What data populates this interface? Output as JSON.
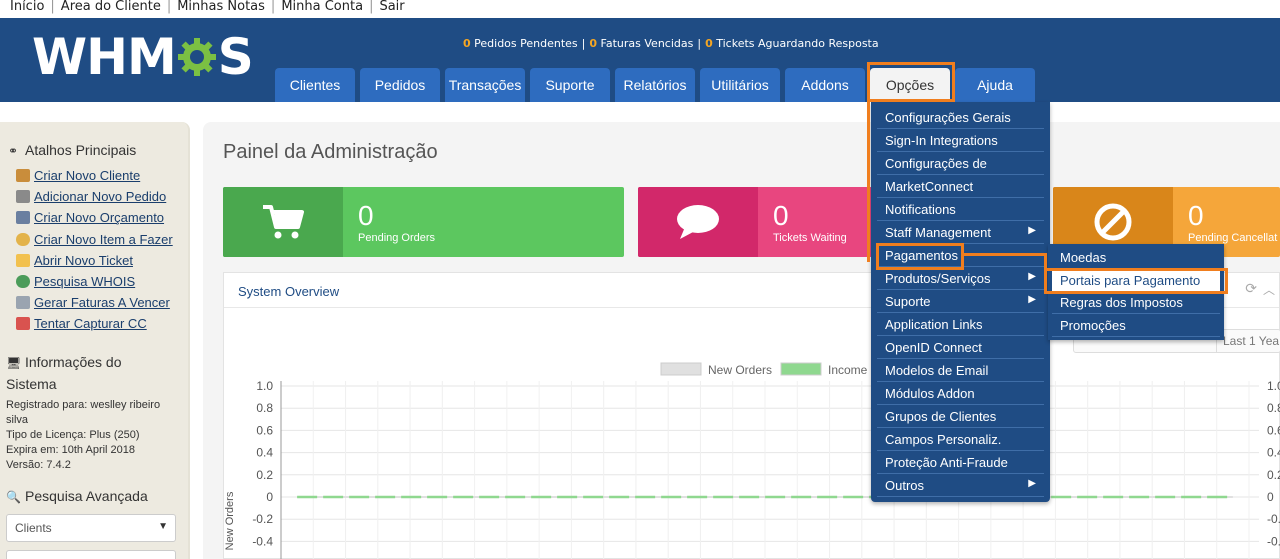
{
  "toplinks": [
    "Início",
    "Área do Cliente",
    "Minhas Notas",
    "Minha Conta",
    "Sair"
  ],
  "header": {
    "logo_left": "WHM",
    "logo_right": "S",
    "stats": {
      "pending_orders_num": "0",
      "pending_orders": "Pedidos Pendentes",
      "overdue_num": "0",
      "overdue": "Faturas Vencidas",
      "tickets_num": "0",
      "tickets": "Tickets Aguardando Resposta"
    },
    "tabs": [
      "Clientes",
      "Pedidos",
      "Transações",
      "Suporte",
      "Relatórios",
      "Utilitários",
      "Addons",
      "Opções",
      "Ajuda"
    ]
  },
  "sidebar": {
    "shortcuts_title": "Atalhos Principais",
    "shortcuts": [
      "Criar Novo Cliente",
      "Adicionar Novo Pedido",
      "Criar Novo Orçamento",
      "Criar Novo Item a Fazer",
      "Abrir Novo Ticket",
      "Pesquisa WHOIS",
      "Gerar Faturas A Vencer",
      "Tentar Capturar CC"
    ],
    "sysinfo_title_1": "Informações do",
    "sysinfo_title_2": "Sistema",
    "registered_1": "Registrado para: weslley ribeiro",
    "registered_2": "silva",
    "license": "Tipo de Licença: Plus (250)",
    "expires": "Expira em: 10th April 2018",
    "version": "Versão: 7.4.2",
    "search_title": "Pesquisa Avançada",
    "search_select": "Clients"
  },
  "main": {
    "title": "Painel da Administração",
    "stats": [
      {
        "num": "0",
        "label": "Pending Orders",
        "color": "#5cc75f",
        "icon_bg": "#4aa84e"
      },
      {
        "num": "0",
        "label": "Tickets Waiting",
        "color": "#e8467f",
        "icon_bg": "#d2286a"
      },
      {
        "num": "0",
        "label": "Pending Cancellat",
        "color": "#f5a63a",
        "icon_bg": "#d9861a"
      }
    ],
    "overview_title": "System Overview",
    "range_label": "Last 1 Yea"
  },
  "chart_data": {
    "type": "line",
    "series": [
      {
        "name": "New Orders",
        "values": [
          0,
          0,
          0,
          0,
          0,
          0,
          0,
          0,
          0,
          0,
          0,
          0,
          0,
          0,
          0,
          0,
          0,
          0,
          0,
          0,
          0,
          0,
          0,
          0,
          0,
          0,
          0,
          0,
          0,
          0
        ],
        "color": "#e0e0e0"
      },
      {
        "name": "Income",
        "values": [
          0,
          0,
          0,
          0,
          0,
          0,
          0,
          0,
          0,
          0,
          0,
          0,
          0,
          0,
          0,
          0,
          0,
          0,
          0,
          0,
          0,
          0,
          0,
          0,
          0,
          0,
          0,
          0,
          0,
          0
        ],
        "color": "#8fd88f"
      }
    ],
    "yticks": [
      "1.0",
      "0.8",
      "0.6",
      "0.4",
      "0.2",
      "0",
      "-0.2",
      "-0.4"
    ],
    "yticks_right": [
      "1.0",
      "0.8",
      "0.6",
      "0.4",
      "0.2",
      "0",
      "-0.2",
      "-0.4"
    ],
    "ylabel": "New Orders",
    "ylim": [
      -0.4,
      1.0
    ],
    "grid": true,
    "legend_position": "top-center"
  },
  "dropdown": {
    "items": [
      "Configurações Gerais",
      "Sign-In Integrations",
      "Configurações de",
      "MarketConnect",
      "Notifications",
      "Staff Management",
      "Pagamentos",
      "Produtos/Serviços",
      "Suporte",
      "Application Links",
      "OpenID Connect",
      "Modelos de Email",
      "Módulos Addon",
      "Grupos de Clientes",
      "Campos Personaliz.",
      "Proteção Anti-Fraude",
      "Outros"
    ],
    "submenu": [
      "Moedas",
      "Portais para Pagamento",
      "Regras dos Impostos",
      "Promoções"
    ]
  },
  "colors": {
    "header": "#1f4c84",
    "tab": "#2e6cbf",
    "highlight": "#f07e1e",
    "gear_green": "#7bc043"
  }
}
